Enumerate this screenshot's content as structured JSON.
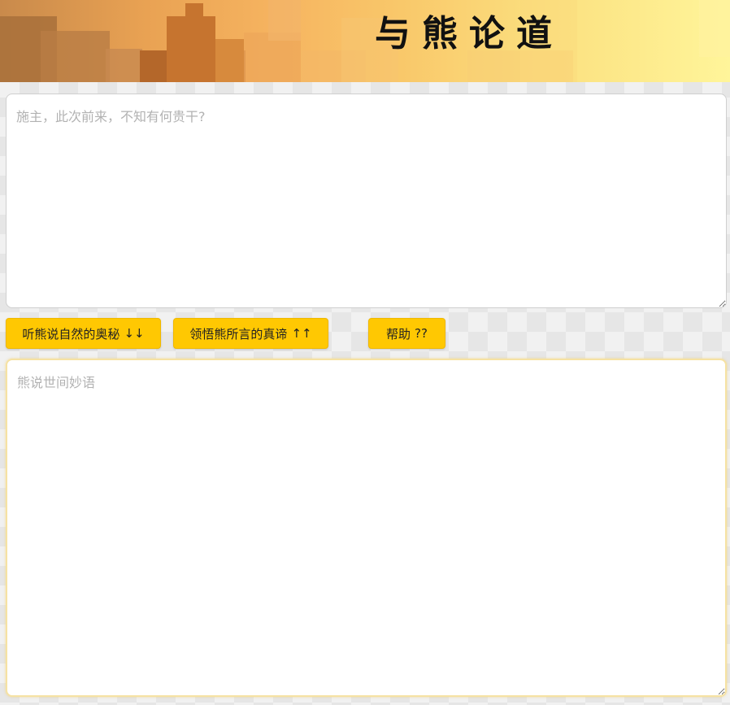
{
  "banner": {
    "title": "与熊论道"
  },
  "input": {
    "placeholder": "施主，此次前来，不知有何贵干?",
    "value": ""
  },
  "buttons": {
    "encode_label": "听熊说自然的奥秘",
    "encode_symbol": "↓↓",
    "decode_label": "领悟熊所言的真谛",
    "decode_symbol": "↑↑",
    "help_label": "帮助",
    "help_symbol": "??"
  },
  "output": {
    "placeholder": "熊说世间妙语",
    "value": ""
  },
  "colors": {
    "button": "#ffc802",
    "output_border": "#f6e2a3"
  }
}
